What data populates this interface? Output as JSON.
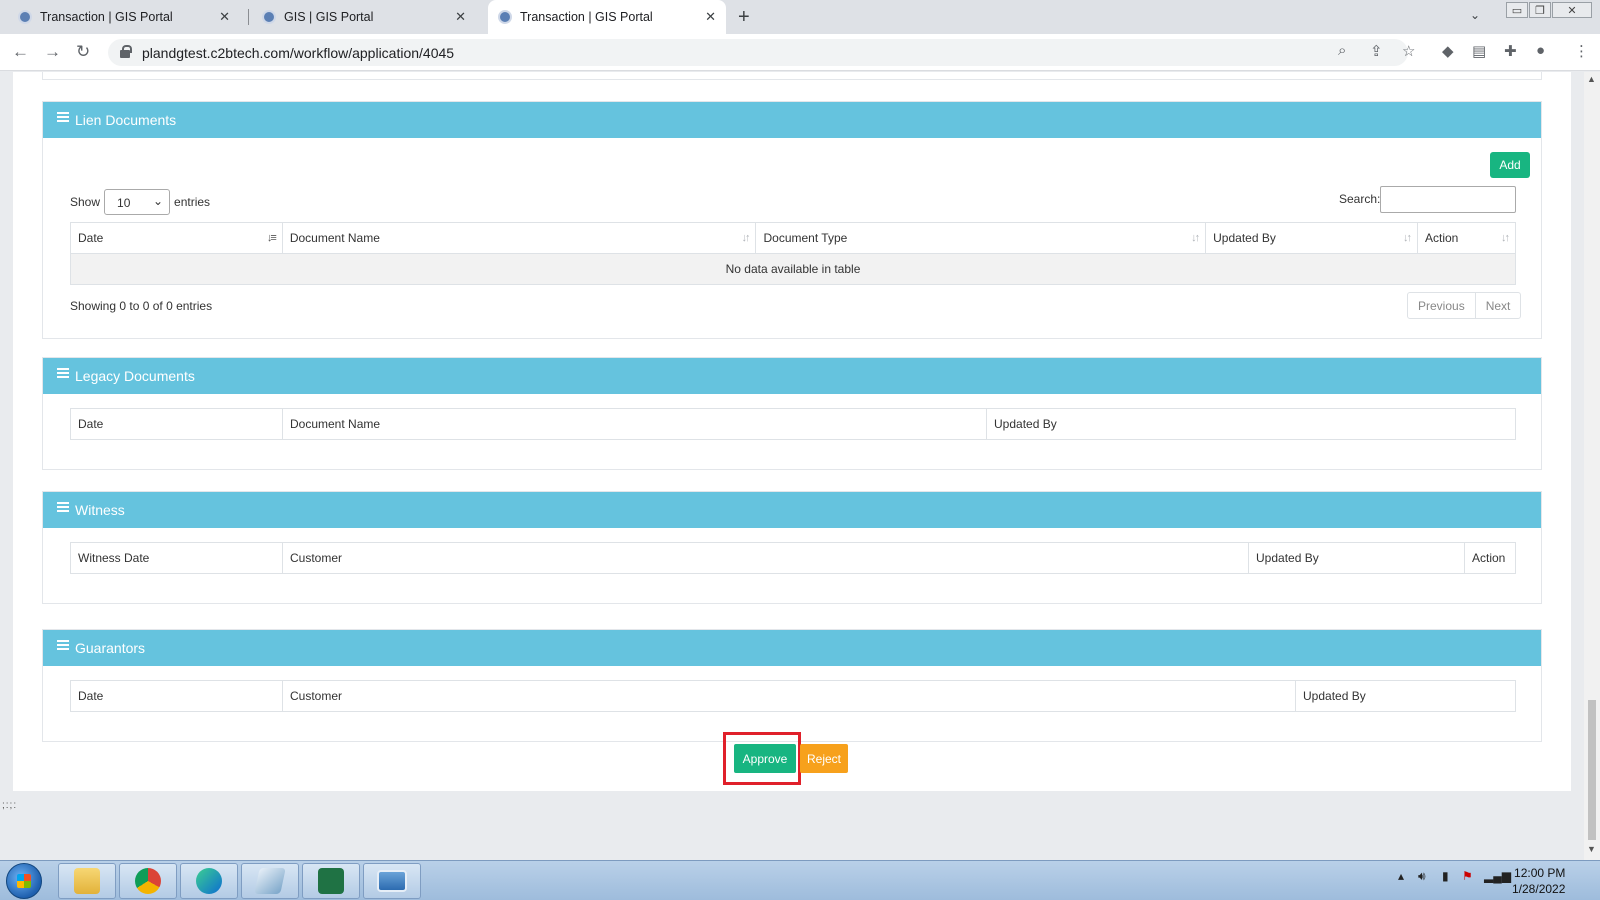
{
  "browser": {
    "tabs": [
      {
        "title": "Transaction | GIS Portal",
        "active": false
      },
      {
        "title": "GIS | GIS Portal",
        "active": false
      },
      {
        "title": "Transaction | GIS Portal",
        "active": true
      }
    ],
    "new_tab": "+",
    "url": "plandgtest.c2btech.com/workflow/application/4045"
  },
  "lien": {
    "title": "Lien Documents",
    "add_label": "Add",
    "show_label": "Show",
    "entries_count": "10",
    "entries_label": "entries",
    "search_label": "Search:",
    "columns": [
      "Date",
      "Document Name",
      "Document Type",
      "Updated By",
      "Action"
    ],
    "empty_message": "No data available in table",
    "info": "Showing 0 to 0 of 0 entries",
    "previous": "Previous",
    "next": "Next"
  },
  "legacy": {
    "title": "Legacy Documents",
    "columns": [
      "Date",
      "Document Name",
      "Updated By"
    ]
  },
  "witness": {
    "title": "Witness",
    "columns": [
      "Witness Date",
      "Customer",
      "Updated By",
      "Action"
    ]
  },
  "guarantors": {
    "title": "Guarantors",
    "columns": [
      "Date",
      "Customer",
      "Updated By"
    ]
  },
  "actions": {
    "approve": "Approve",
    "reject": "Reject"
  },
  "footer_dots": ";:;:",
  "taskbar": {
    "time": "12:00 PM",
    "date": "1/28/2022"
  },
  "colors": {
    "panel_header": "#65c3de",
    "approve": "#18b581",
    "reject": "#f7a11c",
    "highlight": "#e0202a"
  }
}
